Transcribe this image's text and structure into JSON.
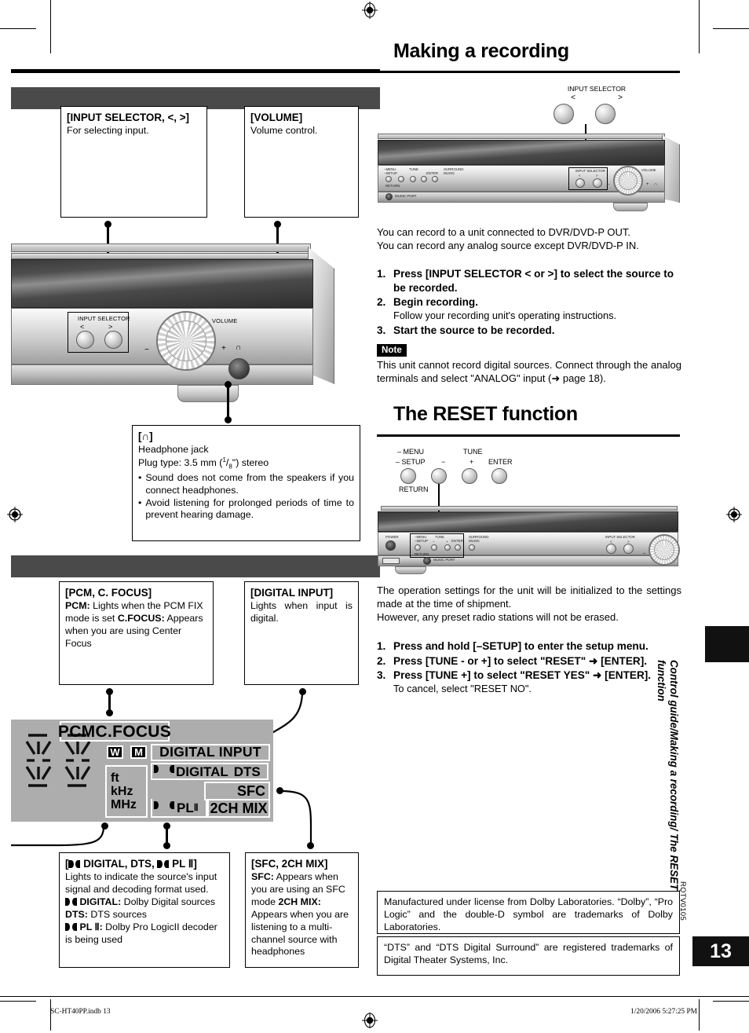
{
  "left_column": {
    "callout_input_selector": {
      "title": "[INPUT SELECTOR, <, >]",
      "body": "For selecting input."
    },
    "callout_volume": {
      "title": "[VOLUME]",
      "body": "Volume control."
    },
    "callout_headphone": {
      "title": "[∩]",
      "line1": "Headphone jack",
      "line2": "Plug type: 3.5 mm (⅛\") stereo",
      "bullet1": "Sound does not come from the speakers if you connect headphones.",
      "bullet2": "Avoid listening for prolonged periods of time to prevent hearing damage."
    },
    "callout_pcm": {
      "title": "[PCM, C. FOCUS]",
      "pcm_label": "PCM:",
      "pcm_text": " Lights when the PCM FIX mode is set",
      "cfocus_label": "C.FOCUS:",
      "cfocus_text": " Appears when you are using Center Focus"
    },
    "callout_digital_input": {
      "title": "[DIGITAL INPUT]",
      "body": "Lights when input is digital."
    },
    "callout_digital_dts": {
      "title_pre": "[",
      "title_post": " DIGITAL, DTS, ",
      "title_post2": " PL Ⅱ]",
      "body": "Lights to indicate the source's input signal and decoding format used.",
      "dd_label": " DIGITAL:",
      "dd_text": " Dolby Digital sources",
      "dts_label": "DTS:",
      "dts_text": " DTS sources",
      "pl_label": " PL Ⅱ:",
      "pl_text": " Dolby Pro LogicII decoder is being used"
    },
    "callout_sfc": {
      "title": "[SFC, 2CH MIX]",
      "sfc_label": "SFC:",
      "sfc_text": " Appears when you are using an SFC mode",
      "mix_label": "2CH MIX:",
      "mix_text": " Appears when you are listening to a multi-channel source with headphones"
    },
    "unit_front": {
      "input_selector_label": "INPUT SELECTOR",
      "arrow_left": "<",
      "arrow_right": ">",
      "volume_label": "VOLUME",
      "minus": "−",
      "plus": "+",
      "headphone_glyph": "∩"
    },
    "fluorescent_display": {
      "pcm": "PCM",
      "cfocus": "C.FOCUS",
      "w": "W",
      "m": "M",
      "digital_input": "DIGITAL  INPUT",
      "digital": "DIGITAL",
      "dts": "DTS",
      "pl": "PL",
      "pl_roman": "Ⅱ",
      "sfc": "SFC",
      "twoch_mix": "2CH MIX",
      "ft": "ft",
      "khz": "kHz",
      "mhz": "MHz"
    }
  },
  "right_column": {
    "recording": {
      "heading": "Making a recording",
      "diagram": {
        "input_selector_label": "INPUT SELECTOR",
        "arrow_left": "<",
        "arrow_right": ">"
      },
      "intro_line1": "You can record to a unit connected to DVR/DVD-P OUT.",
      "intro_line2": "You can record any analog source except DVR/DVD-P IN.",
      "steps": [
        {
          "num": "1.",
          "text": "Press [INPUT SELECTOR < or >] to select the source to be recorded.",
          "sub": ""
        },
        {
          "num": "2.",
          "text": "Begin recording.",
          "sub": "Follow your recording unit's operating instructions."
        },
        {
          "num": "3.",
          "text": "Start the source to be recorded.",
          "sub": ""
        }
      ],
      "note_tag": "Note",
      "note_text": "This unit cannot record digital sources. Connect through the analog terminals and select \"ANALOG\" input (➜ page 18)."
    },
    "reset": {
      "heading": "The RESET function",
      "diagram": {
        "menu": "– MENU",
        "setup": "– SETUP",
        "return": "RETURN",
        "minus": "−",
        "tune": "TUNE",
        "plus": "+",
        "enter": "ENTER"
      },
      "intro_line1": "The operation settings for the unit will be initialized to the settings made at the time of shipment.",
      "intro_line2": "However, any preset radio stations will not be erased.",
      "steps": [
        {
          "num": "1.",
          "text": "Press and hold [–SETUP] to enter the setup menu.",
          "sub": ""
        },
        {
          "num": "2.",
          "text": "Press [TUNE - or +] to select \"RESET\" ➜ [ENTER].",
          "sub": ""
        },
        {
          "num": "3.",
          "text": "Press [TUNE +] to select \"RESET YES\" ➜ [ENTER].",
          "sub": "To cancel, select \"RESET NO\"."
        }
      ]
    },
    "trademarks": {
      "dolby": "Manufactured under license from Dolby Laboratories. “Dolby”, “Pro Logic” and the double-D symbol are trademarks of Dolby Laboratories.",
      "dts": "“DTS” and “DTS Digital Surround” are registered trademarks of Digital Theater Systems, Inc."
    }
  },
  "margin": {
    "vertical_title": "Control guide/Making a recording/ The RESET function",
    "rqt_code": "RQTV0105",
    "page_number": "13"
  },
  "footer": {
    "file": "SC-HT40PP.indb   13",
    "timestamp": "1/20/2006   5:27:25 PM"
  }
}
